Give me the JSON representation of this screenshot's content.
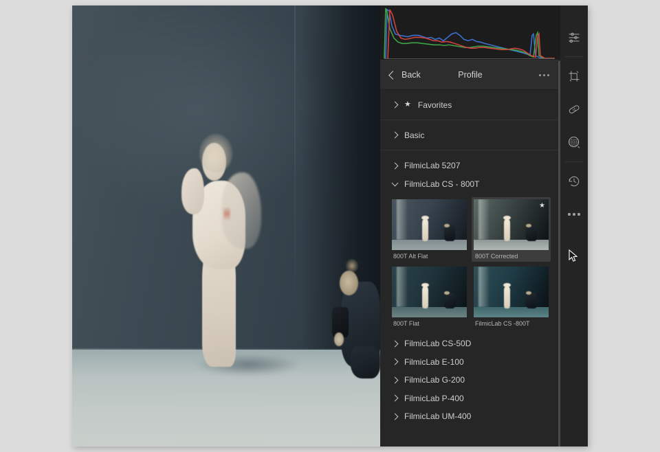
{
  "app": {
    "panel_background": "#262626",
    "accent_selected": "#3d3d3d"
  },
  "histogram": {
    "name": "rgb-histogram",
    "channels": [
      "red",
      "green",
      "blue"
    ],
    "colors": {
      "red": "#d0433f",
      "green": "#3fa34a",
      "blue": "#3d6fd0"
    }
  },
  "panel_header": {
    "back_label": "Back",
    "title": "Profile",
    "more_label": "..."
  },
  "groups": [
    {
      "label": "Favorites",
      "expanded": false,
      "starred": true
    },
    {
      "label": "Basic",
      "expanded": false,
      "starred": false
    },
    {
      "label": "FilmicLab 5207",
      "expanded": false,
      "starred": false
    },
    {
      "label": "FilmicLab CS - 800T",
      "expanded": true,
      "starred": false
    }
  ],
  "profiles": [
    {
      "label": "800T Alt Flat",
      "selected": false,
      "favorite": false,
      "theme": "t-altflat"
    },
    {
      "label": "800T Corrected",
      "selected": true,
      "favorite": true,
      "theme": "t-corrected"
    },
    {
      "label": "800T Flat",
      "selected": false,
      "favorite": false,
      "theme": "t-flat"
    },
    {
      "label": "FilmicLab CS -800T",
      "selected": false,
      "favorite": false,
      "theme": "t-cs800t"
    }
  ],
  "more_groups": [
    {
      "label": "FilmicLab CS-50D"
    },
    {
      "label": "FilmicLab E-100"
    },
    {
      "label": "FilmicLab G-200"
    },
    {
      "label": "FilmicLab P-400"
    },
    {
      "label": "FilmicLab UM-400"
    }
  ],
  "toolbar": [
    {
      "icon": "sliders-icon",
      "label": "Edit"
    },
    {
      "icon": "crop-icon",
      "label": "Crop"
    },
    {
      "icon": "healing-brush-icon",
      "label": "Healing"
    },
    {
      "icon": "masking-icon",
      "label": "Masking"
    },
    {
      "icon": "history-clock-icon",
      "label": "History"
    },
    {
      "icon": "more-dots-icon",
      "label": "More"
    }
  ],
  "photo": {
    "name": "dancer-photograph",
    "description": "Dancer in pale outfit against dark wall with crouching photographer"
  },
  "star_glyph": "★"
}
